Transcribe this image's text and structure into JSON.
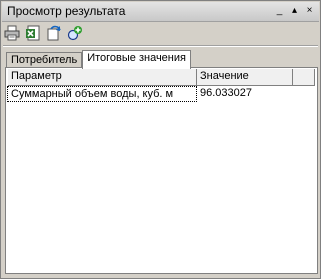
{
  "window": {
    "title": "Просмотр результата"
  },
  "titlebar_buttons": [
    {
      "name": "minimize",
      "glyph": "_"
    },
    {
      "name": "restore",
      "glyph": "▴"
    },
    {
      "name": "close",
      "glyph": "×"
    }
  ],
  "toolbar": {
    "tools": [
      {
        "name": "print",
        "icon": "printer-icon"
      },
      {
        "name": "excel-export",
        "icon": "excel-icon"
      },
      {
        "name": "refresh",
        "icon": "refresh-icon"
      },
      {
        "name": "add-layer",
        "icon": "add-layer-icon"
      }
    ]
  },
  "tabs": [
    {
      "label": "Потребитель",
      "active": false
    },
    {
      "label": "Итоговые значения",
      "active": true
    }
  ],
  "grid": {
    "headers": [
      "Параметр",
      "Значение"
    ],
    "rows": [
      [
        "Суммарный объем воды, куб. м",
        "96.033027"
      ]
    ]
  }
}
